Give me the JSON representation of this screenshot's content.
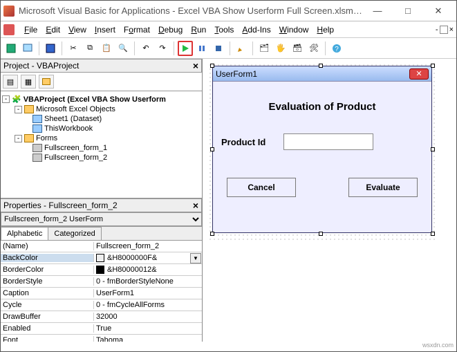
{
  "window": {
    "title": "Microsoft Visual Basic for Applications - Excel VBA Show Userform Full Screen.xlsm - [Exce..."
  },
  "menu": {
    "file": "File",
    "edit": "Edit",
    "view": "View",
    "insert": "Insert",
    "format": "Format",
    "debug": "Debug",
    "run": "Run",
    "tools": "Tools",
    "addins": "Add-Ins",
    "window": "Window",
    "help": "Help"
  },
  "projectPanel": {
    "title": "Project - VBAProject"
  },
  "tree": {
    "root": "VBAProject (Excel VBA Show Userform",
    "group1": "Microsoft Excel Objects",
    "sheet1": "Sheet1 (Dataset)",
    "thiswb": "ThisWorkbook",
    "group2": "Forms",
    "form1": "Fullscreen_form_1",
    "form2": "Fullscreen_form_2"
  },
  "propsPanel": {
    "title": "Properties - Fullscreen_form_2",
    "selector": "Fullscreen_form_2 UserForm",
    "tab1": "Alphabetic",
    "tab2": "Categorized"
  },
  "props": {
    "name_k": "(Name)",
    "name_v": "Fullscreen_form_2",
    "backcolor_k": "BackColor",
    "backcolor_v": "&H8000000F&",
    "bordercolor_k": "BorderColor",
    "bordercolor_v": "&H80000012&",
    "borderstyle_k": "BorderStyle",
    "borderstyle_v": "0 - fmBorderStyleNone",
    "caption_k": "Caption",
    "caption_v": "UserForm1",
    "cycle_k": "Cycle",
    "cycle_v": "0 - fmCycleAllForms",
    "drawbuffer_k": "DrawBuffer",
    "drawbuffer_v": "32000",
    "enabled_k": "Enabled",
    "enabled_v": "True",
    "font_k": "Font",
    "font_v": "Tahoma"
  },
  "uform": {
    "caption": "UserForm1",
    "heading": "Evaluation of Product",
    "label": "Product Id",
    "btn_cancel": "Cancel",
    "btn_eval": "Evaluate"
  },
  "footer": "wsxdn.com"
}
